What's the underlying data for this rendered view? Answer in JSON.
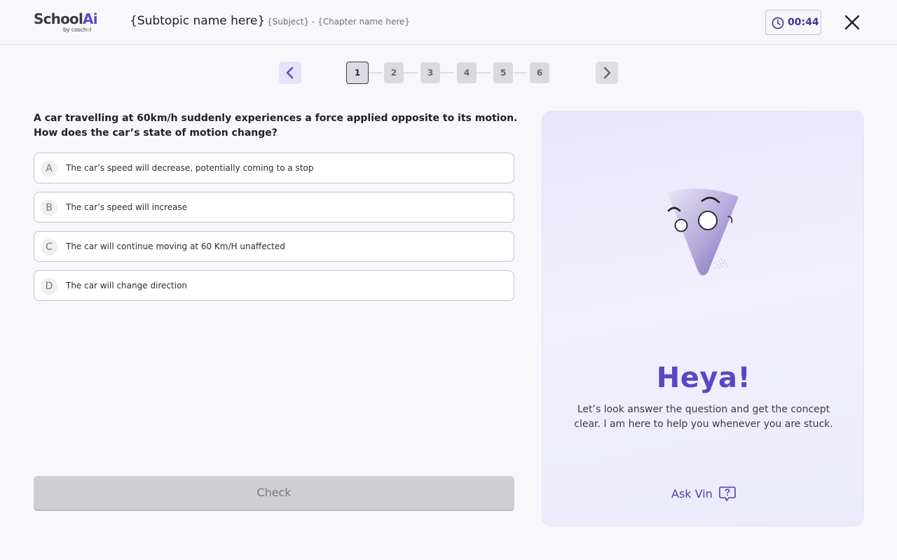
{
  "header": {
    "logo_main": "School",
    "logo_ai": "Ai",
    "logo_sub": "by cosch",
    "logo_sub_dot": "o",
    "logo_sub_end": "l",
    "subtopic": "{Subtopic name here}",
    "subject": "{Subject} - {Chapter name here}",
    "timer": "00:44"
  },
  "pager": {
    "steps": [
      "1",
      "2",
      "3",
      "4",
      "5",
      "6"
    ],
    "active": "1"
  },
  "question": {
    "text": "A car travelling at 60km/h suddenly experiences a force applied opposite to its motion. How does the car’s state of motion change?",
    "options": [
      {
        "letter": "A",
        "text": "The car’s speed will decrease, potentially coming to a stop"
      },
      {
        "letter": "B",
        "text": "The car’s speed will increase"
      },
      {
        "letter": "C",
        "text": "The car will continue moving at 60 Km/H unaffected"
      },
      {
        "letter": "D",
        "text": "The car will change direction"
      }
    ],
    "check_label": "Check"
  },
  "panel": {
    "heading": "Heya!",
    "message": "Let’s look answer the question and get the concept clear. I am here to help you whenever you are stuck.",
    "ask_label": "Ask Vin",
    "ask_icon": "question-bubble-icon"
  },
  "colors": {
    "accent": "#5b46c4",
    "background": "#f8f7fc",
    "panel": "#ecebfc",
    "check_disabled": "#cfcfd3"
  }
}
